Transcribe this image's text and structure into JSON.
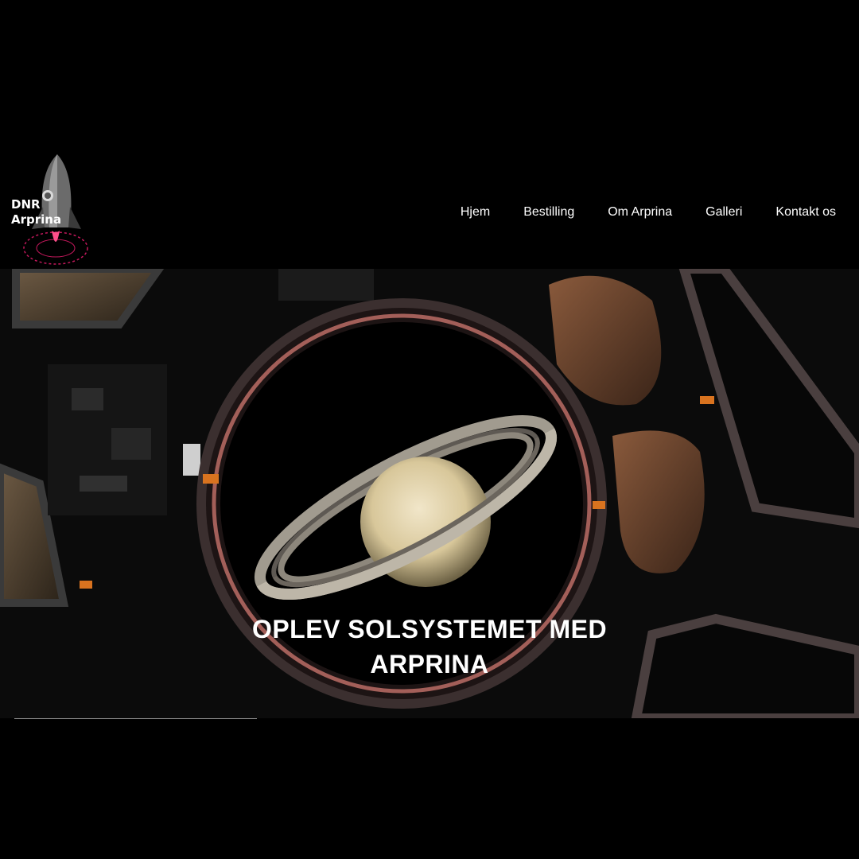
{
  "logo": {
    "line1": "DNR",
    "line2": "Arprina",
    "icon": "rocket-icon"
  },
  "nav": {
    "items": [
      {
        "label": "Hjem"
      },
      {
        "label": "Bestilling"
      },
      {
        "label": "Om Arprina"
      },
      {
        "label": "Galleri"
      },
      {
        "label": "Kontakt os"
      }
    ]
  },
  "hero": {
    "title_line1": "OPLEV SOLSYSTEMET MED",
    "title_line2": "ARPRINA",
    "image": "space-station-window-saturn"
  },
  "colors": {
    "background": "#000000",
    "text": "#ffffff",
    "accent": "#e0457b"
  }
}
